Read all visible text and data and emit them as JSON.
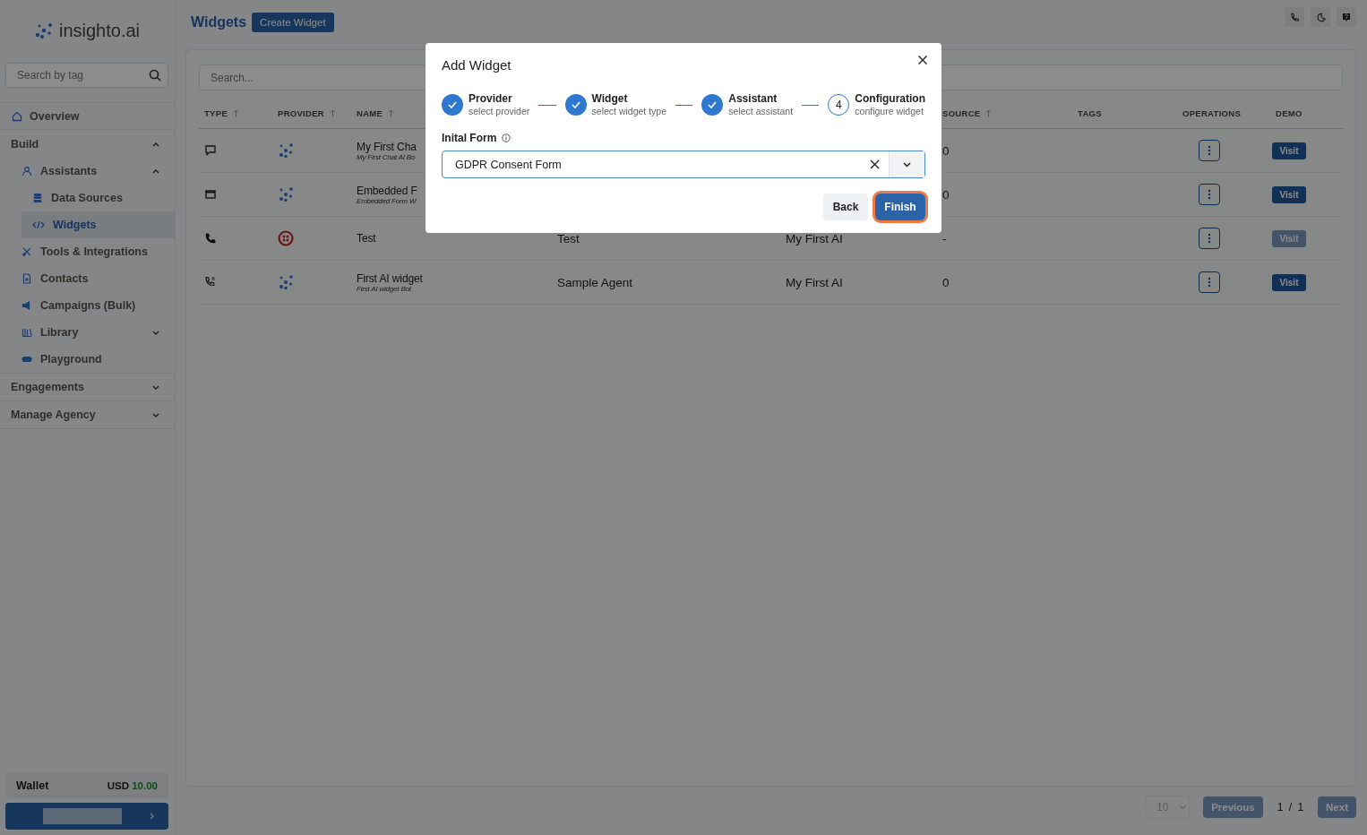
{
  "brand": "insighto.ai",
  "sidebar": {
    "search": {
      "placeholder": "Search by tag"
    },
    "nav": [
      {
        "label": "Overview",
        "kind": "link",
        "selected": false
      },
      {
        "label": "Build",
        "kind": "section",
        "expanded": true,
        "children": [
          {
            "label": "Assistants",
            "expanded": true,
            "selected": false,
            "children": [
              {
                "label": "Data Sources",
                "selected": false
              },
              {
                "label": "Widgets",
                "selected": true
              }
            ]
          },
          {
            "label": "Tools & Integrations",
            "selected": false
          },
          {
            "label": "Contacts",
            "selected": false
          },
          {
            "label": "Campaigns (Bulk)",
            "selected": false
          },
          {
            "label": "Library",
            "expanded": false,
            "selected": false
          },
          {
            "label": "Playground",
            "selected": false
          }
        ]
      },
      {
        "label": "Engagements",
        "kind": "section",
        "expanded": false
      },
      {
        "label": "Manage Agency",
        "kind": "section",
        "expanded": false
      }
    ],
    "wallet": {
      "label": "Wallet",
      "currency": "USD",
      "amount": "10.00"
    }
  },
  "header": {
    "title": "Widgets",
    "create_button": "Create Widget"
  },
  "search": {
    "placeholder": "Search..."
  },
  "table": {
    "columns": [
      "TYPE",
      "PROVIDER",
      "NAME",
      "",
      "",
      "SOURCE",
      "TAGS",
      "OPERATIONS",
      "DEMO"
    ],
    "rows": [
      {
        "name": "My First Cha",
        "subtitle": "My First Chat AI Bo",
        "column_4": "",
        "column_5": "",
        "source": "0",
        "visit": "Visit",
        "disabled": false
      },
      {
        "name": "Embedded F",
        "subtitle": "Embedded Form W",
        "column_4": "",
        "column_5": "",
        "source": "0",
        "visit": "Visit",
        "disabled": false
      },
      {
        "name": "Test",
        "column_4": "Test",
        "column_5": "My First AI",
        "source": "-",
        "visit": "Visit",
        "disabled": true
      },
      {
        "name": "First AI widget",
        "subtitle": "First AI widget Bot",
        "column_4": "Sample Agent",
        "column_5": "My First AI",
        "source": "0",
        "visit": "Visit",
        "disabled": false
      }
    ]
  },
  "pagination": {
    "page_size": "10",
    "previous": "Previous",
    "page": "1",
    "separator": "/",
    "pages": "1",
    "next": "Next",
    "disabled": true
  },
  "modal": {
    "title": "Add Widget",
    "steps": [
      {
        "label": "Provider",
        "sub": "select provider",
        "done": true
      },
      {
        "label": "Widget",
        "sub": "select widget type",
        "done": true
      },
      {
        "label": "Assistant",
        "sub": "select assistant",
        "done": true
      },
      {
        "label": "Configuration",
        "sub": "configure widget",
        "done": false,
        "number": "4"
      }
    ],
    "field_label": "Inital Form",
    "value": "GDPR Consent Form",
    "back": "Back",
    "finish": "Finish"
  }
}
